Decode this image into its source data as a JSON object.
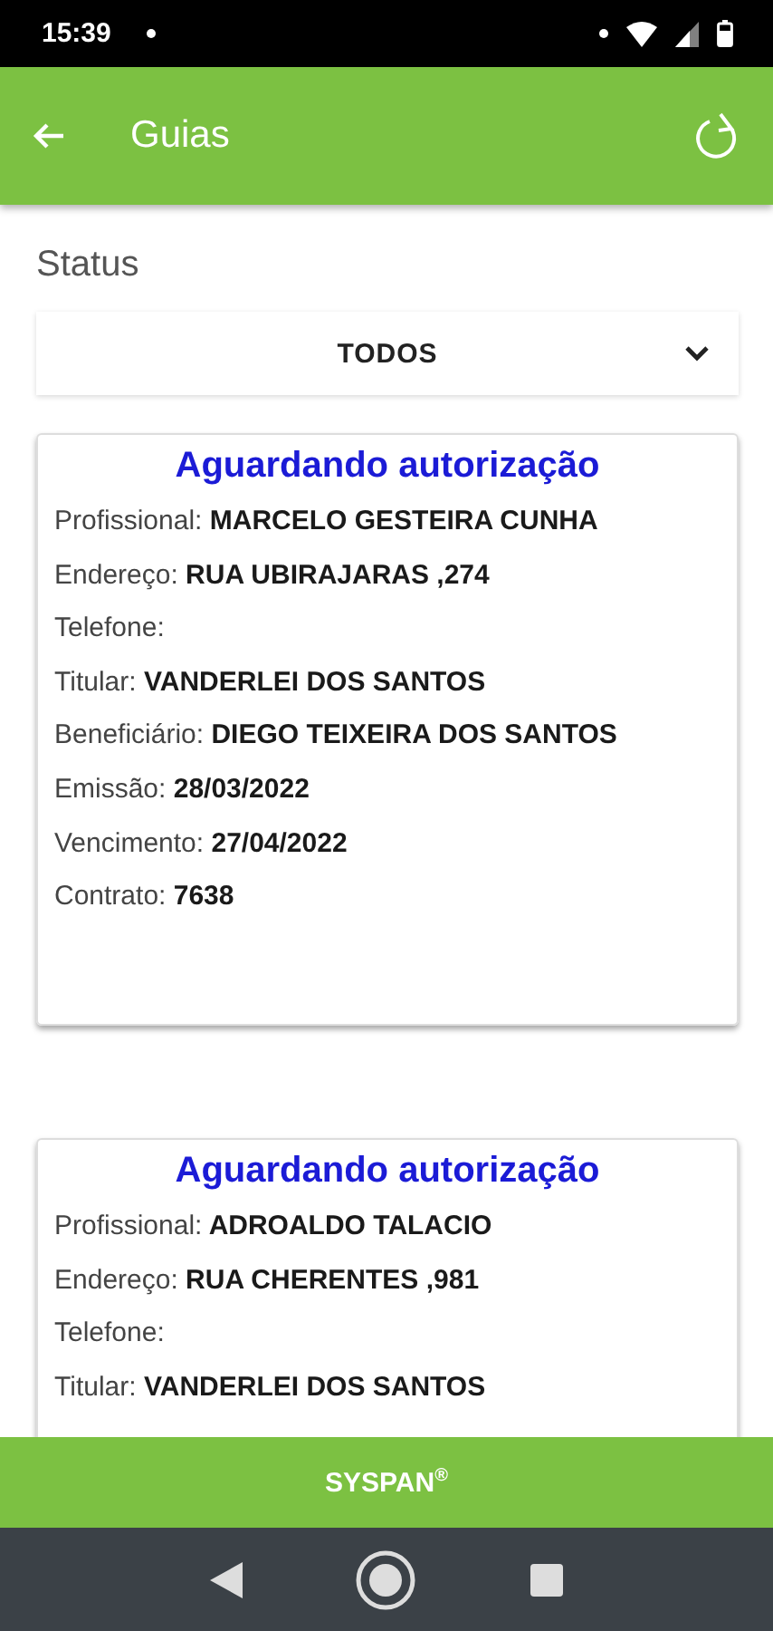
{
  "status_bar": {
    "time": "15:39"
  },
  "app_bar": {
    "title": "Guias"
  },
  "filter": {
    "label": "Status",
    "value": "TODOS"
  },
  "cards": [
    {
      "title": "Aguardando autorização",
      "fields": [
        {
          "label": "Profissional:",
          "value": "MARCELO GESTEIRA CUNHA"
        },
        {
          "label": "Endereço:",
          "value": "RUA UBIRAJARAS ,274"
        },
        {
          "label": "Telefone:"
        },
        {
          "label": "Titular:",
          "value": "VANDERLEI DOS SANTOS"
        },
        {
          "label": "Beneficiário:",
          "value": "DIEGO TEIXEIRA DOS SANTOS"
        },
        {
          "label": "Emissão:",
          "value": "28/03/2022"
        },
        {
          "label": "Vencimento:",
          "value": "27/04/2022"
        },
        {
          "label": "Contrato:",
          "value": "7638"
        }
      ]
    },
    {
      "title": "Aguardando autorização",
      "fields": [
        {
          "label": "Profissional:",
          "value": "ADROALDO TALACIO"
        },
        {
          "label": "Endereço:",
          "value": "RUA CHERENTES ,981"
        },
        {
          "label": "Telefone:"
        },
        {
          "label": "Titular:",
          "value": "VANDERLEI DOS SANTOS"
        }
      ]
    }
  ],
  "footer": {
    "brand": "SYSPAN$^{®}$"
  }
}
